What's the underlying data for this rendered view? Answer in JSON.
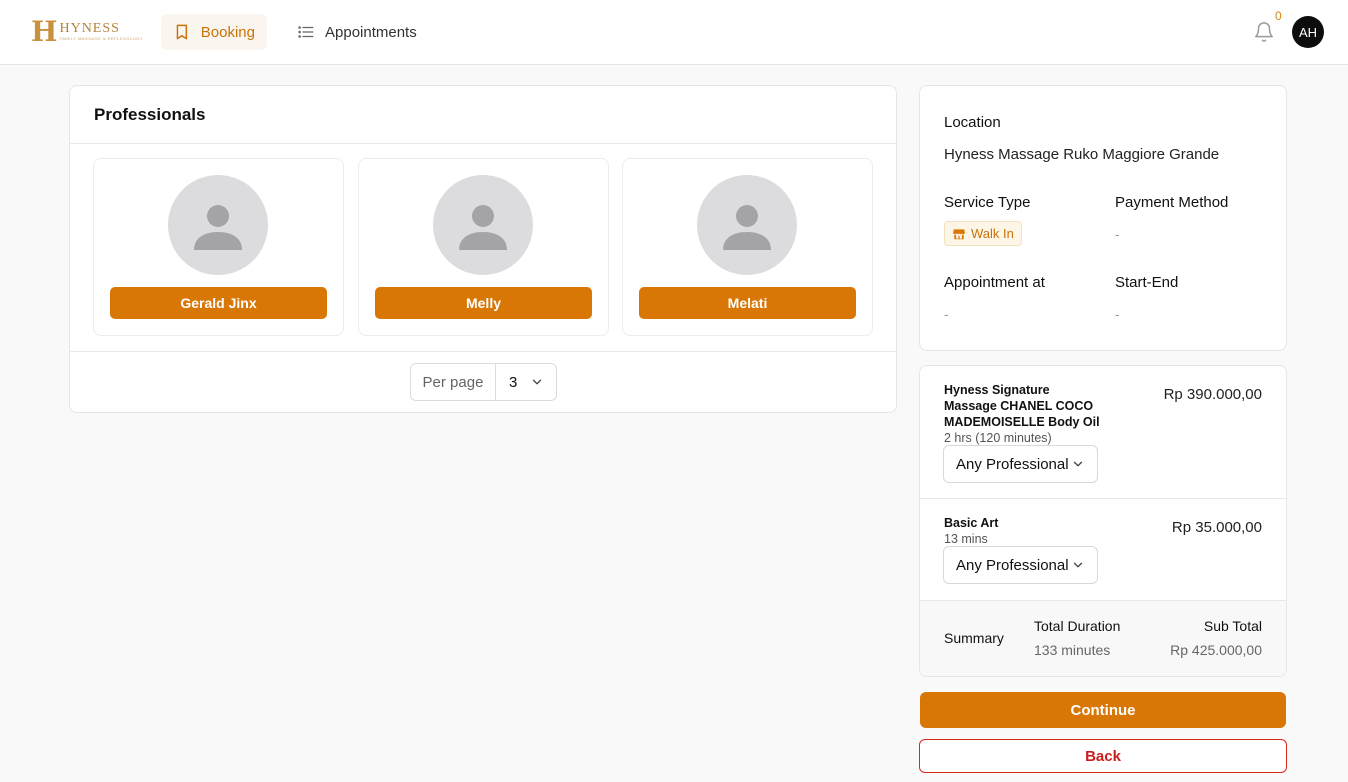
{
  "header": {
    "logo_mark": "H",
    "logo_name": "HYNESS",
    "logo_sub": "FAMILY MASSAGE & REFLEXOLOGY",
    "nav": [
      {
        "label": "Booking",
        "icon": "bookmark-icon",
        "active": true
      },
      {
        "label": "Appointments",
        "icon": "list-icon",
        "active": false
      }
    ],
    "notification_count": "0",
    "user_initials": "AH"
  },
  "professionals": {
    "title": "Professionals",
    "items": [
      {
        "name": "Gerald Jinx"
      },
      {
        "name": "Melly"
      },
      {
        "name": "Melati"
      }
    ],
    "per_page_label": "Per page",
    "per_page_value": "3"
  },
  "booking_info": {
    "location_label": "Location",
    "location_value": "Hyness Massage Ruko Maggiore Grande",
    "service_type_label": "Service Type",
    "service_type_value": "Walk In",
    "payment_method_label": "Payment Method",
    "payment_method_value": "-",
    "appointment_label": "Appointment at",
    "appointment_value": "-",
    "start_end_label": "Start-End",
    "start_end_value": "-"
  },
  "services": [
    {
      "name": "Hyness Signature Massage CHANEL COCO MADEMOISELLE Body Oil",
      "duration": "2 hrs (120 minutes)",
      "price": "Rp 390.000,00",
      "professional": "Any Professional"
    },
    {
      "name": "Basic Art",
      "duration": "13 mins",
      "price": "Rp 35.000,00",
      "professional": "Any Professional"
    }
  ],
  "summary": {
    "label": "Summary",
    "total_duration_label": "Total Duration",
    "total_duration_value": "133 minutes",
    "sub_total_label": "Sub Total",
    "sub_total_value": "Rp 425.000,00"
  },
  "actions": {
    "continue_label": "Continue",
    "back_label": "Back"
  },
  "colors": {
    "accent": "#d97706",
    "danger": "#dc2626"
  }
}
